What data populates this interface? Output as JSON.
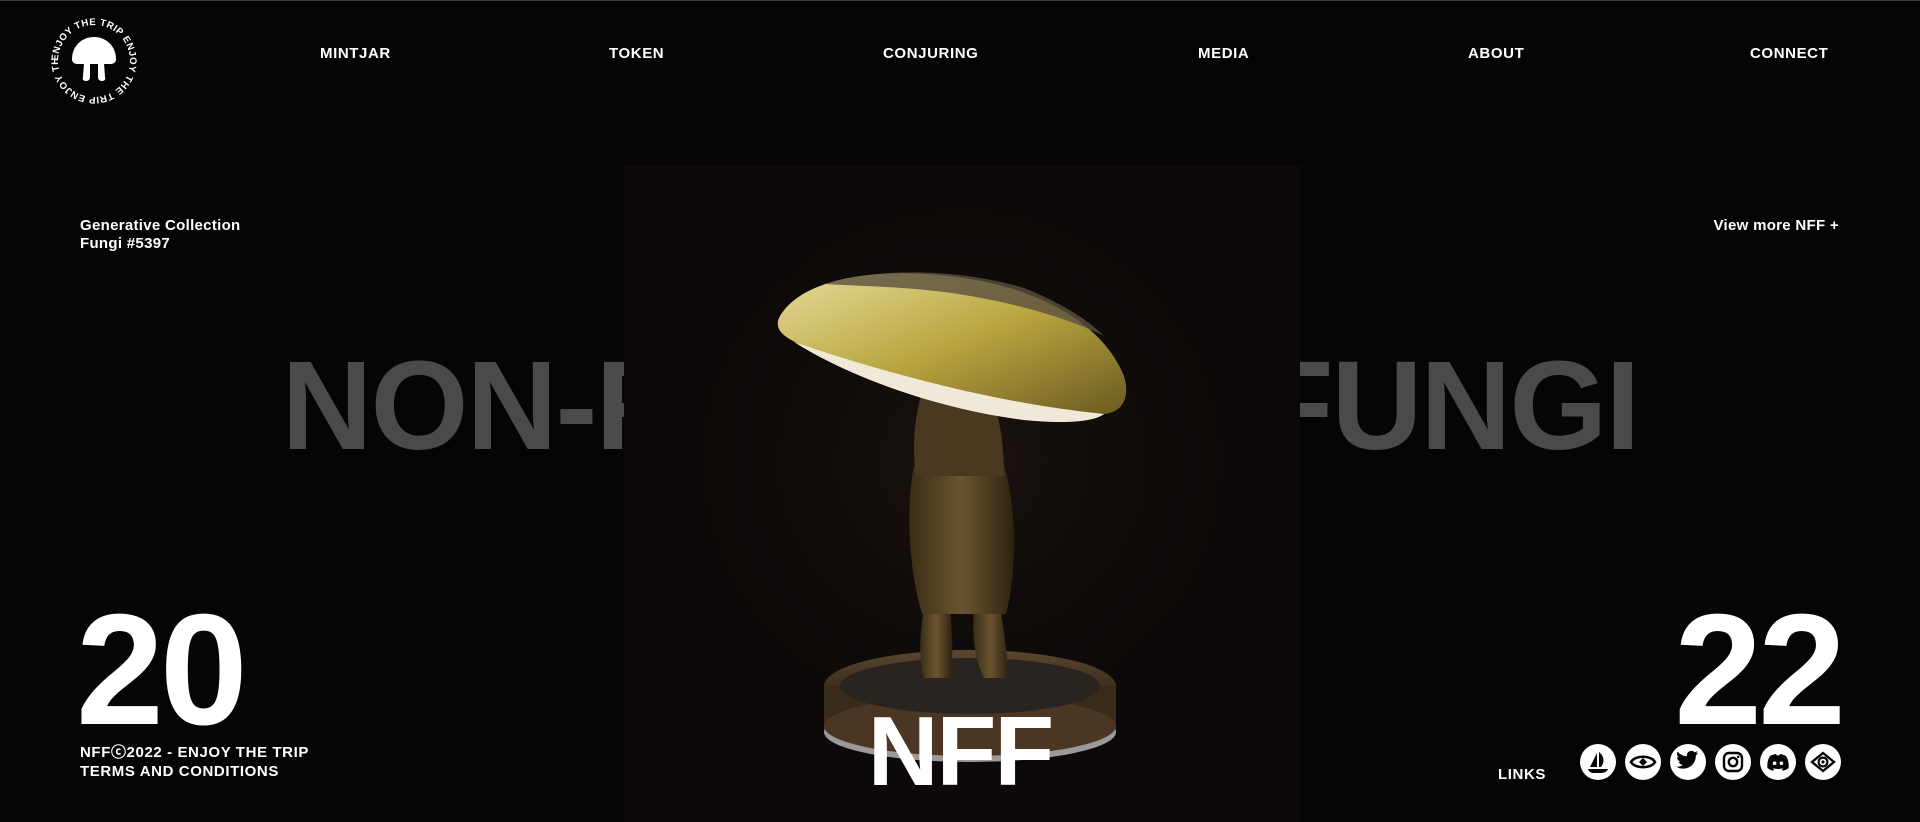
{
  "brand": {
    "logo_ring_text": "ENJOY THE TRIP ENJOY THE TRIP ENJOY THE TRIP"
  },
  "nav": {
    "items": [
      "MINTJAR",
      "TOKEN",
      "CONJURING",
      "MEDIA",
      "ABOUT",
      "CONNECT"
    ]
  },
  "collection": {
    "line1": "Generative Collection",
    "line2": "Fungi #5397"
  },
  "view_more": "View more NFF +",
  "hero": {
    "title": "NON-FUNGIBLE FUNGI",
    "year_left": "20",
    "year_right": "22",
    "center_mark": "NFF"
  },
  "footer": {
    "copyright": "NFFⓒ2022 - ENJOY THE TRIP",
    "terms": "TERMS AND CONDITIONS",
    "links_label": "LINKS"
  },
  "social_icons": [
    "opensea-icon",
    "magic-eden-icon",
    "twitter-icon",
    "instagram-icon",
    "discord-icon",
    "looksrare-icon"
  ],
  "colors": {
    "background": "#050505",
    "text": "#ffffff",
    "title_gray": "#4a4a4a"
  }
}
